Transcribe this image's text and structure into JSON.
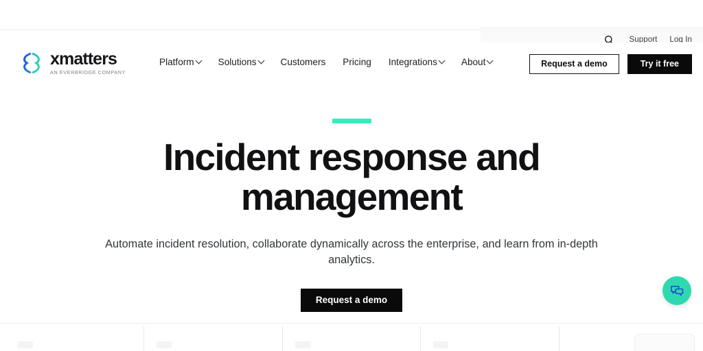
{
  "brand": {
    "wordmark": "xmatters",
    "tagline": "AN EVERBRIDGE COMPANY",
    "logo_color_left": "#1668dd",
    "logo_color_right": "#2ed0a8"
  },
  "utility": {
    "search_icon": "search-icon",
    "links": [
      {
        "label": "Support"
      },
      {
        "label": "Log In"
      }
    ]
  },
  "nav": {
    "items": [
      {
        "label": "Platform",
        "has_dropdown": true
      },
      {
        "label": "Solutions",
        "has_dropdown": true
      },
      {
        "label": "Customers",
        "has_dropdown": false
      },
      {
        "label": "Pricing",
        "has_dropdown": false
      },
      {
        "label": "Integrations",
        "has_dropdown": true
      },
      {
        "label": "About",
        "has_dropdown": true
      }
    ]
  },
  "header_actions": {
    "demo_label": "Request a demo",
    "trial_label": "Try it free"
  },
  "hero": {
    "accent_color": "#3aebc0",
    "title": "Incident response and management",
    "subtitle": "Automate incident resolution, collaborate dynamically across the enterprise, and learn from in-depth analytics.",
    "cta_label": "Request a demo"
  },
  "chat": {
    "icon": "chat-bubbles-icon",
    "background_color": "#2fd9b0",
    "glyph_color": "#1f51c9"
  },
  "below_fold": {
    "columns": 5
  }
}
